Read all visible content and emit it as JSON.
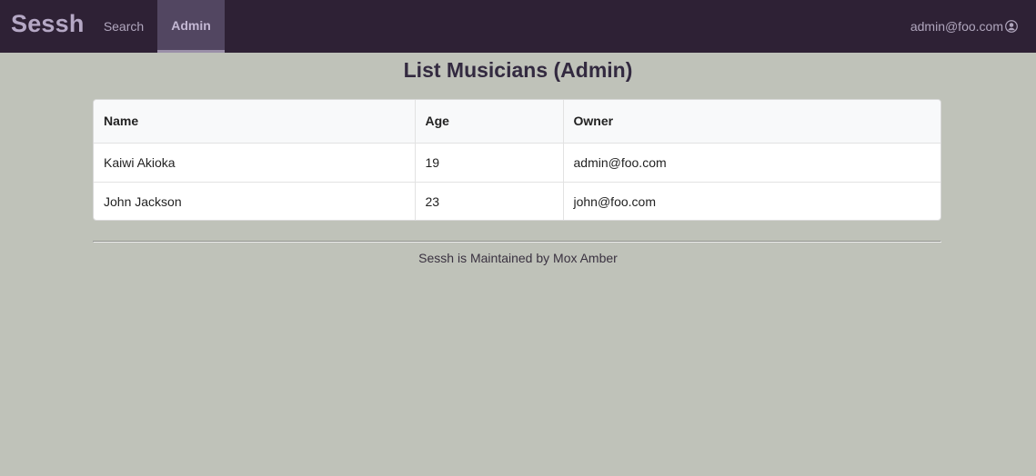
{
  "navbar": {
    "brand": "Sessh",
    "links": [
      {
        "label": "Search",
        "active": false
      },
      {
        "label": "Admin",
        "active": true
      }
    ],
    "user": {
      "email": "admin@foo.com",
      "icon": "user-circle-icon"
    }
  },
  "page": {
    "title": "List Musicians (Admin)"
  },
  "table": {
    "columns": [
      "Name",
      "Age",
      "Owner"
    ],
    "rows": [
      {
        "name": "Kaiwi Akioka",
        "age": "19",
        "owner": "admin@foo.com"
      },
      {
        "name": "John Jackson",
        "age": "23",
        "owner": "john@foo.com"
      }
    ]
  },
  "footer": {
    "text": "Sessh is Maintained by Mox Amber"
  },
  "colors": {
    "navbar_bg": "#2e2135",
    "page_bg": "#bfc2b9",
    "active_tab_bg": "#524661"
  }
}
